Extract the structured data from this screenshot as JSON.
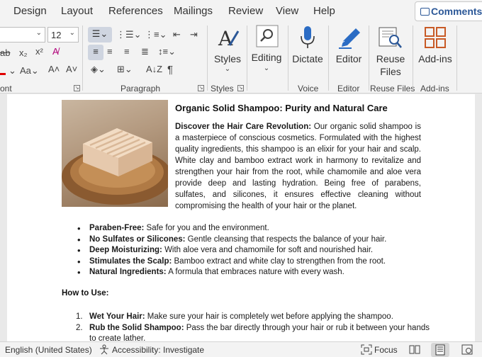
{
  "tabs": [
    "Design",
    "Layout",
    "References",
    "Mailings",
    "Review",
    "View",
    "Help"
  ],
  "comments_label": "Comments",
  "font": {
    "size": "12"
  },
  "font_group_label": "ont",
  "paragraph_group_label": "Paragraph",
  "styles": {
    "label": "Styles",
    "group_label": "Styles"
  },
  "editing": {
    "label": "Editing"
  },
  "voice": {
    "label": "Dictate",
    "group_label": "Voice"
  },
  "editor": {
    "label": "Editor",
    "group_label": "Editor"
  },
  "reuse": {
    "label_line1": "Reuse",
    "label_line2": "Files",
    "group_label": "Reuse Files"
  },
  "addins": {
    "label": "Add-ins",
    "group_label": "Add-ins"
  },
  "doc": {
    "title": "Organic Solid Shampoo: Purity and Natural Care",
    "intro_lead": "Discover the Hair Care Revolution:",
    "intro_text": " Our organic solid shampoo is a masterpiece of conscious cosmetics. Formulated with the highest quality ingredients, this shampoo is an elixir for your hair and scalp. White clay and bamboo extract work in harmony to revitalize and strengthen your hair from the root, while chamomile and aloe vera provide deep and lasting hydration. Being free of parabens, sulfates, and silicones, it ensures effective cleaning without compromising the health of your hair or the planet.",
    "bullets": [
      {
        "lead": "Paraben-Free:",
        "text": " Safe for you and the environment."
      },
      {
        "lead": "No Sulfates or Silicones:",
        "text": " Gentle cleansing that respects the balance of your hair."
      },
      {
        "lead": "Deep Moisturizing:",
        "text": " With aloe vera and chamomile for soft and nourished hair."
      },
      {
        "lead": "Stimulates the Scalp:",
        "text": " Bamboo extract and white clay to strengthen from the root."
      },
      {
        "lead": "Natural Ingredients:",
        "text": " A formula that embraces nature with every wash."
      }
    ],
    "howto_title": "How to Use:",
    "steps": [
      {
        "num": "1.",
        "lead": "Wet Your Hair:",
        "text": " Make sure your hair is completely wet before applying the shampoo."
      },
      {
        "num": "2.",
        "lead": "Rub the Solid Shampoo:",
        "text": " Pass the bar directly through your hair or rub it between your hands to create lather."
      }
    ]
  },
  "status": {
    "language": "English (United States)",
    "accessibility": "Accessibility: Investigate",
    "focus": "Focus"
  },
  "colors": {
    "accent": "#2b5797",
    "ribbon_bg": "#f3f3f3",
    "selected_bg": "#cfd5e0"
  },
  "icons": [
    "comment-icon",
    "styles-icon",
    "search-icon",
    "microphone-icon",
    "editor-pen-icon",
    "reuse-files-icon",
    "add-ins-grid-icon",
    "accessibility-icon",
    "focus-icon",
    "read-mode-icon",
    "print-layout-icon",
    "web-layout-icon"
  ]
}
